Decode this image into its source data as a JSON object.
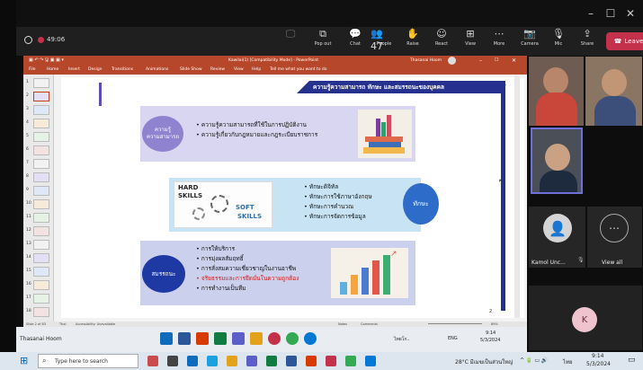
{
  "meeting": {
    "timer": "49:06",
    "window_controls": [
      "–",
      "☐",
      "✕"
    ],
    "toolbar": [
      {
        "glyph": "🖵",
        "label": "",
        "dim": true
      },
      {
        "glyph": "⧉",
        "label": "Pop out",
        "dim": false
      },
      {
        "glyph": "💬",
        "label": "Chat",
        "dim": false
      },
      {
        "glyph": "👥",
        "label": "People",
        "count": "47",
        "dim": false
      },
      {
        "glyph": "✋",
        "label": "Raise",
        "dim": false
      },
      {
        "glyph": "☺",
        "label": "React",
        "dim": false
      },
      {
        "glyph": "⊞",
        "label": "View",
        "dim": false
      },
      {
        "glyph": "⋯",
        "label": "More",
        "dim": false
      },
      {
        "glyph": "📷",
        "label": "Camera",
        "dim": false
      },
      {
        "glyph": "🎙",
        "label": "Mic",
        "dim": false
      },
      {
        "glyph": "⇪",
        "label": "Share",
        "dim": false
      }
    ],
    "leave_label": "Leave",
    "leave_color": "#c4314b",
    "participants": [
      {
        "name": "Kamol Unc...",
        "initial": "",
        "muted": true
      },
      {
        "name": "",
        "initial": "K",
        "muted": false
      }
    ],
    "view_all_label": "View all"
  },
  "ppt": {
    "title": "Kawilai(1) [Compatibility Mode] - PowerPoint",
    "user": "Thasanai Hoom",
    "menu": [
      "File",
      "Home",
      "Insert",
      "Design",
      "Transitions",
      "Animations",
      "Slide Show",
      "Review",
      "View",
      "Help",
      "Tell me what you want to do"
    ],
    "thumb_numbers": [
      "1",
      "2",
      "3",
      "4",
      "5",
      "6",
      "7",
      "8",
      "9",
      "10",
      "11",
      "12",
      "13",
      "14",
      "15",
      "16",
      "17",
      "18"
    ],
    "status_left": "Slide 2 of 83",
    "status_mid": "Thai",
    "status_access": "Accessibility: Unavailable",
    "status_notes": "Notes",
    "status_comments": "Comments",
    "zoom": "89%",
    "accent": "#b7472a"
  },
  "slide": {
    "header": "ความรู้ความสามารถ ทักษะ และสมรรถนะของบุคคล",
    "page_number": "2",
    "knowledge": {
      "title_lines": [
        "ความรู้",
        "ความสามารถ"
      ],
      "bullets": [
        "ความรู้ความสามารถที่ใช้ในการปฏิบัติงาน",
        "ความรู้เกี่ยวกับกฎหมายและกฎระเบียบราชการ"
      ]
    },
    "skills": {
      "title": "ทักษะ",
      "image_text": [
        "HARD",
        "SKILLS",
        "SOFT",
        "SKILLS"
      ],
      "bullets": [
        "ทักษะดิจิทัล",
        "ทักษะการใช้ภาษาอังกฤษ",
        "ทักษะการคำนวณ",
        "ทักษะการจัดการข้อมูล"
      ]
    },
    "competency": {
      "title": "สมรรถนะ",
      "bullets": [
        "การให้บริการ",
        "การมุ่งผลสัมฤทธิ์",
        "การสั่งสมความเชี่ยวชาญในงานอาชีพ",
        "จริยธรรมและการยึดมั่นในความถูกต้อง",
        "การทำงานเป็นทีม"
      ]
    }
  },
  "taskbar": {
    "search_placeholder": "Type here to search",
    "weather": "28°C มีเมฆเป็นส่วนใหญ่",
    "lang": "ไทย",
    "time": "9:14",
    "date": "5/3/2024",
    "tray_time": "9:14",
    "tray_date": "5/3/2024",
    "tray_app": "ไทยโก..",
    "tray_lang": "ENG",
    "presenter": "Thasanai Hoom"
  }
}
